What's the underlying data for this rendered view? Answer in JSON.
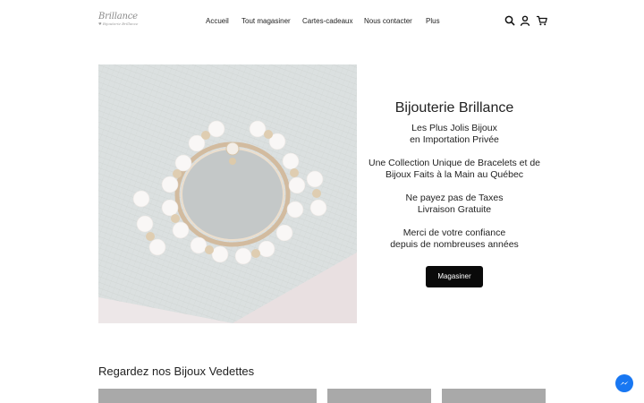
{
  "header": {
    "logo": {
      "main": "Brillance",
      "sub": "♥ Bijouterie Brillance"
    },
    "nav": [
      {
        "label": "Accueil"
      },
      {
        "label": "Tout magasiner"
      },
      {
        "label": "Cartes-cadeaux"
      },
      {
        "label": "Nous contacter"
      },
      {
        "label": "Plus"
      }
    ],
    "icons": [
      "search-icon",
      "account-icon",
      "cart-icon"
    ]
  },
  "hero": {
    "image": "pearl-and-gold-bracelet-on-gift-box",
    "title": "Bijouterie Brillance",
    "lines": [
      "Les Plus Jolis Bijoux",
      "en Importation Privée",
      "Une Collection Unique de Bracelets et de",
      "Bijoux Faits à la Main au Québec",
      "Ne payez pas de Taxes",
      "Livraison Gratuite",
      "Merci de votre confiance",
      "depuis de nombreuses années"
    ],
    "button": "Magasiner"
  },
  "featured": {
    "title": "Regardez nos Bijoux Vedettes"
  },
  "colors": {
    "accent": "#0a0a0a",
    "messenger": "#1877f2",
    "card_placeholder": "#a9a9a9"
  }
}
